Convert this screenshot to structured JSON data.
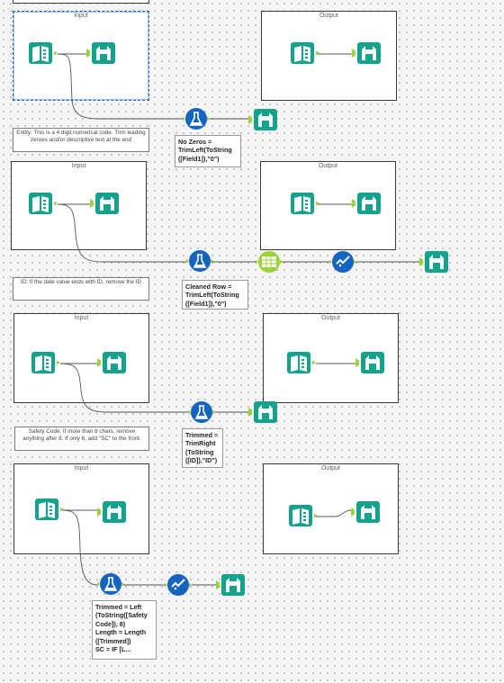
{
  "canvas": {
    "background": "#f4f4f4",
    "accent_teal": "#13a38c",
    "accent_blue": "#1565c0",
    "connector_green": "#9bd43a"
  },
  "groups": [
    {
      "input_title": "Input",
      "output_title": "Output"
    },
    {
      "input_title": "Input",
      "output_title": "Output"
    },
    {
      "input_title": "Input",
      "output_title": "Output"
    },
    {
      "input_title": "Input",
      "output_title": "Output"
    }
  ],
  "comments": [
    "Entity: This is a 4 digit numerical code. Trim leading zeroes and/or descriptive text at the end",
    "ID: If the date value ends with ID, remove the ID",
    "Safety Code: If more than 8 chars, remove anything after 8. If only 6, add \"SC\" to the front."
  ],
  "annotations": [
    "No Zeros =\nTrimLeft(ToString\n([Field1]),\"0\")",
    "Cleaned Row =\nTrimLeft(ToString\n([Field1]),\"0\")",
    "Trimmed =\nTrimRight\n(ToString\n([ID]),\"ID\")",
    "Trimmed = Left\n(ToString([Safety\nCode]), 8)\nLength = Length\n([Trimmed])\nSC = IF [L..."
  ],
  "icons": {
    "input": "input-data-book-icon",
    "browse": "browse-binoculars-icon",
    "formula": "formula-flask-icon",
    "select": "select-columns-icon",
    "check": "check-filter-icon"
  }
}
